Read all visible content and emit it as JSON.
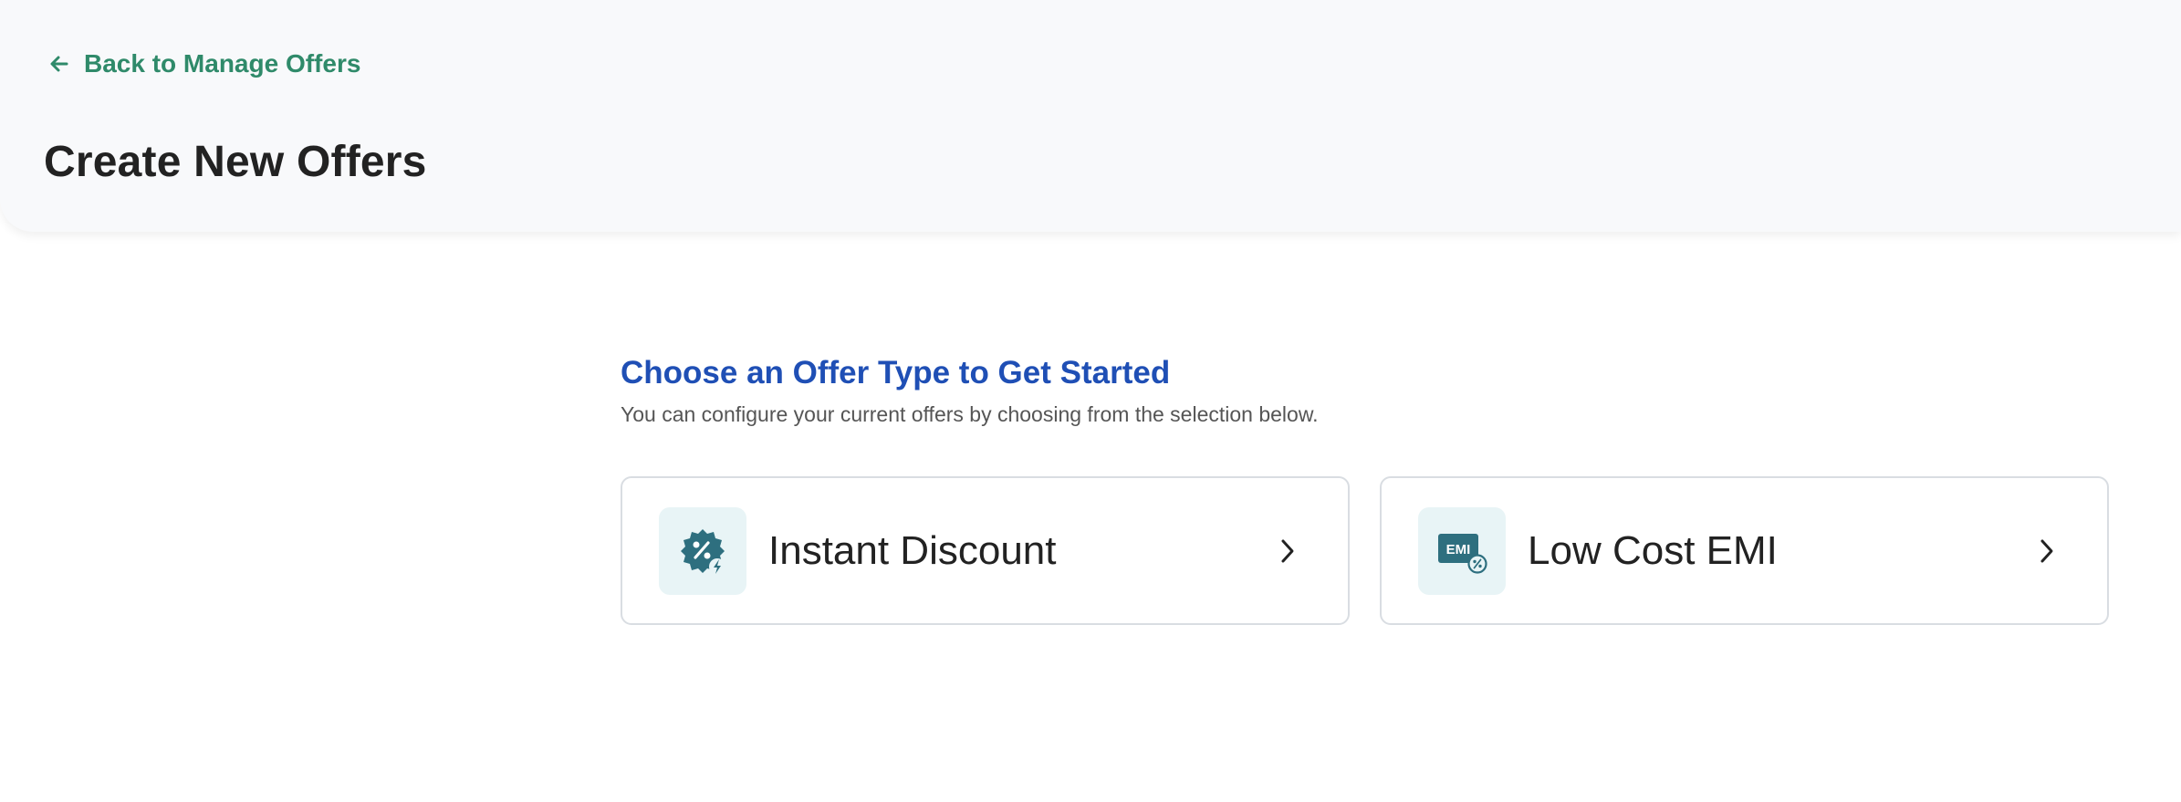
{
  "header": {
    "back_label": "Back to Manage Offers",
    "title": "Create New Offers"
  },
  "section": {
    "title": "Choose an Offer Type to Get Started",
    "subtitle": "You can configure your current offers by choosing from the selection below."
  },
  "offer_types": [
    {
      "label": "Instant Discount",
      "icon": "discount-badge-icon"
    },
    {
      "label": "Low Cost EMI",
      "icon": "emi-icon",
      "icon_text": "EMI"
    }
  ],
  "colors": {
    "accent_green": "#2f8a6a",
    "heading_blue": "#1f4fb5",
    "icon_teal": "#2e6f7f",
    "icon_bg": "#e8f4f6"
  }
}
